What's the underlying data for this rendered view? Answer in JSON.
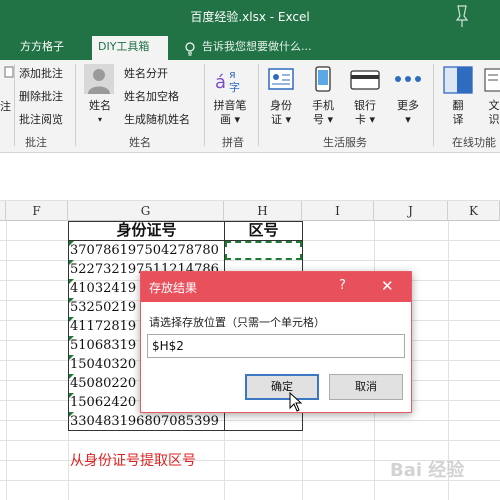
{
  "window": {
    "title": "百度经验.xlsx - Excel"
  },
  "tabs": [
    {
      "label": "方方格子"
    },
    {
      "label": "DIY工具箱"
    }
  ],
  "tell_me": "告诉我您想要做什么...",
  "ribbon": {
    "left_partial_label": "注",
    "group1": {
      "items": [
        "添加批注",
        "删除批注",
        "批注阅览"
      ],
      "label": "批注"
    },
    "group2": {
      "big_button": "姓名",
      "items": [
        "姓名分开",
        "姓名加空格",
        "生成随机姓名"
      ],
      "label": "姓名"
    },
    "group3": {
      "big_button_lines": [
        "拼音笔",
        "画"
      ],
      "label": "拼音"
    },
    "group4": {
      "buttons": [
        {
          "lines": [
            "身份",
            "证"
          ]
        },
        {
          "lines": [
            "手机",
            "号"
          ]
        },
        {
          "lines": [
            "银行",
            "卡"
          ]
        },
        {
          "lines": [
            "更多",
            ""
          ]
        }
      ],
      "label": "生活服务"
    },
    "group5": {
      "buttons": [
        {
          "lines": [
            "翻",
            "译"
          ]
        },
        {
          "lines": [
            "文",
            "识"
          ]
        }
      ],
      "label": "在线功能"
    },
    "icon_colors": {
      "accent": "#217346",
      "blue": "#2f6bbf",
      "purple": "#7a4fc6"
    }
  },
  "columns": [
    "F",
    "G",
    "H",
    "I",
    "J",
    "K"
  ],
  "table": {
    "headers": [
      "身份证号",
      "区号"
    ],
    "id_numbers": [
      "370786197504278780",
      "522732197511214786",
      "41032419",
      "53250219",
      "41172819",
      "51068319",
      "15040320",
      "45080220",
      "15062420",
      "330483196807085399"
    ]
  },
  "dialog": {
    "title": "存放结果",
    "help": "?",
    "close": "✕",
    "prompt": "请选择存放位置（只需一个单元格）",
    "input_value": "$H$2",
    "ok": "确定",
    "cancel": "取消"
  },
  "caption": "从身份证号提取区号",
  "watermark": "Bai 经验"
}
